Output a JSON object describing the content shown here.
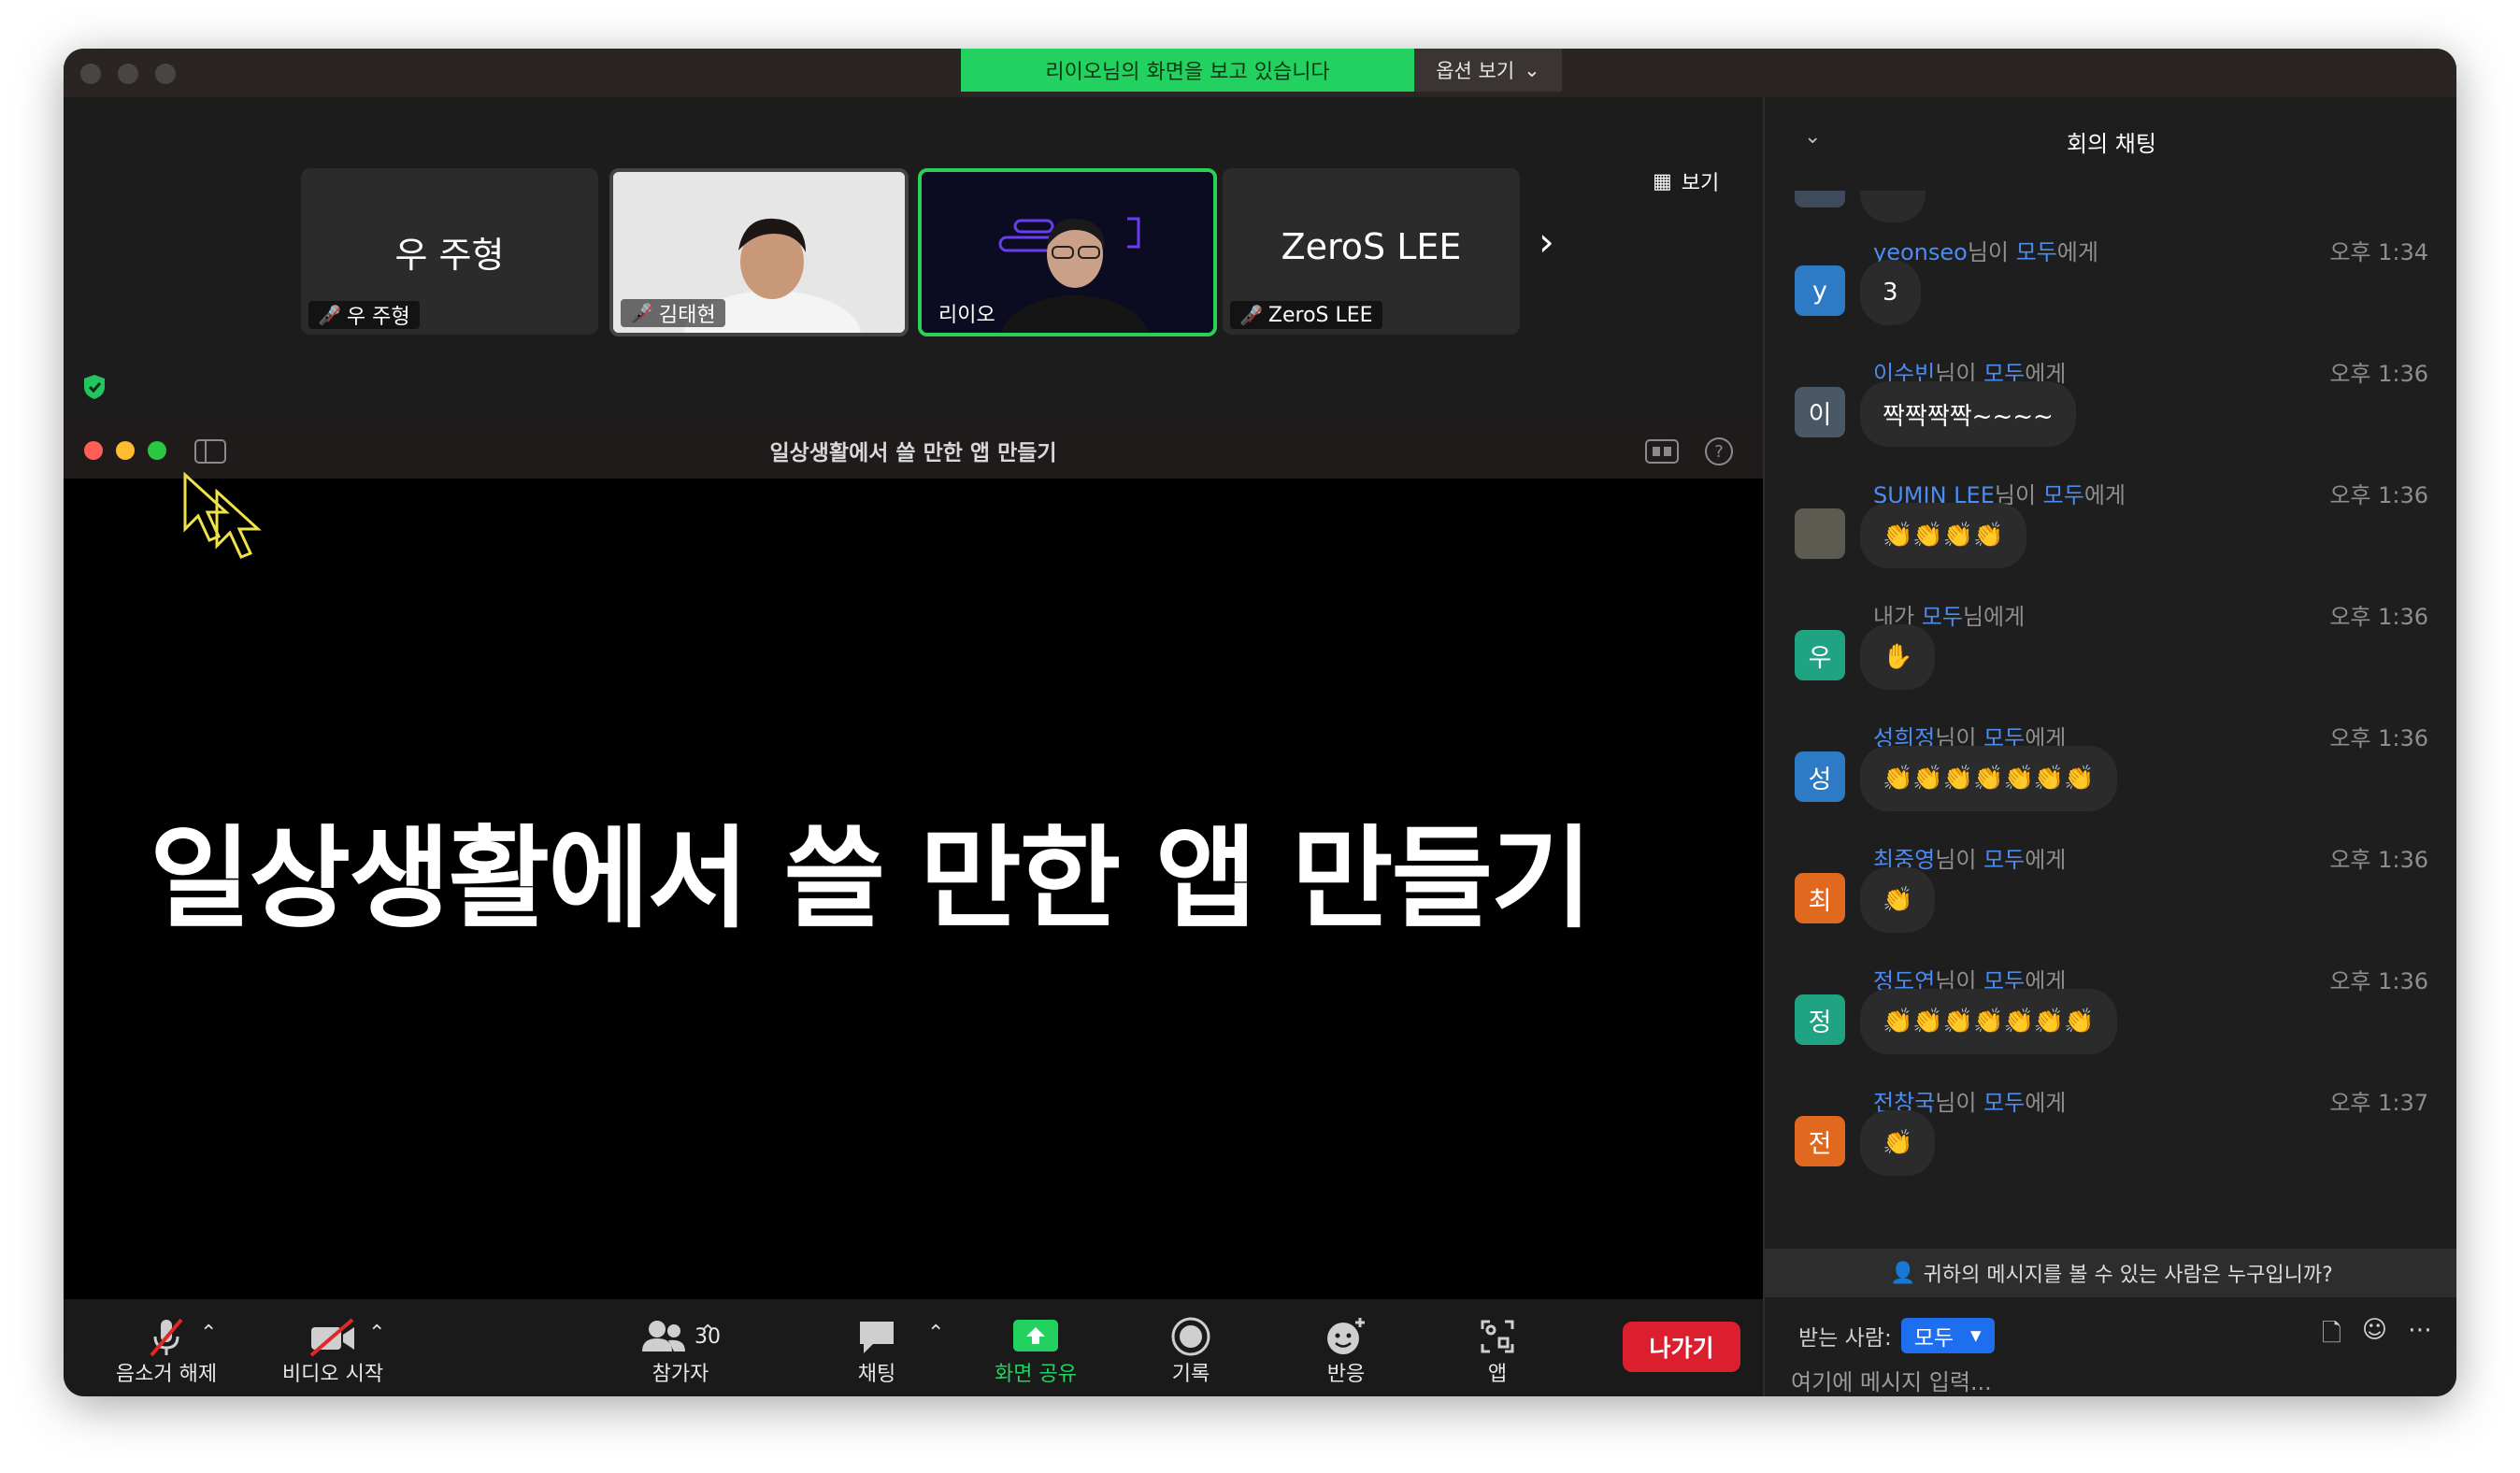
{
  "banner": {
    "sharing_text": "리이오님의 화면을 보고 있습니다",
    "view_options_label": "옵션 보기"
  },
  "thumbnails": [
    {
      "display_name": "우 주형",
      "label": "우 주형",
      "muted": true,
      "type": "name"
    },
    {
      "label": "김태현",
      "muted": true,
      "type": "video"
    },
    {
      "label": "리이오",
      "muted": false,
      "type": "video",
      "active_speaker": true
    },
    {
      "display_name": "ZeroS LEE",
      "label": "ZeroS LEE",
      "muted": true,
      "type": "name"
    }
  ],
  "view_button_label": "보기",
  "shared_window": {
    "title": "일상생활에서 쓸 만한 앱 만들기",
    "slide_text": "일상생활에서 쓸 만한 앱 만들기"
  },
  "toolbar": {
    "unmute_label": "음소거 해제",
    "video_label": "비디오 시작",
    "participants_label": "참가자",
    "participants_count": "30",
    "chat_label": "채팅",
    "share_label": "화면 공유",
    "record_label": "기록",
    "reactions_label": "반응",
    "apps_label": "앱",
    "leave_label": "나가기"
  },
  "chat": {
    "title": "회의 채팅",
    "messages": [
      {
        "sender": "yeonseo",
        "suffix": "님이 ",
        "target": "모두",
        "target_suffix": "에게",
        "time": "오후 1:34",
        "avatar_text": "y",
        "avatar_color": "#2d7bc4",
        "text": "3"
      },
      {
        "sender": "이수빈",
        "suffix": "님이 ",
        "target": "모두",
        "target_suffix": "에게",
        "time": "오후 1:36",
        "avatar_text": "이",
        "avatar_color": "#4a5866",
        "text": "짝짝짝짝~~~~"
      },
      {
        "sender": "SUMIN LEE",
        "suffix": "님이 ",
        "target": "모두",
        "target_suffix": "에게",
        "time": "오후 1:36",
        "avatar_text": "",
        "avatar_color": "#5d5a52",
        "text": "👏👏👏👏"
      },
      {
        "sender": "내가 ",
        "suffix": "",
        "target": "모두",
        "target_suffix": "님에게",
        "time": "오후 1:36",
        "avatar_text": "우",
        "avatar_color": "#1fa383",
        "text": "✋",
        "self": true
      },
      {
        "sender": "성희정",
        "suffix": "님이 ",
        "target": "모두",
        "target_suffix": "에게",
        "time": "오후 1:36",
        "avatar_text": "성",
        "avatar_color": "#2d7bc4",
        "text": "👏👏👏👏👏👏👏"
      },
      {
        "sender": "최중영",
        "suffix": "님이 ",
        "target": "모두",
        "target_suffix": "에게",
        "time": "오후 1:36",
        "avatar_text": "최",
        "avatar_color": "#e0681f",
        "text": "👏"
      },
      {
        "sender": "정도연",
        "suffix": "님이 ",
        "target": "모두",
        "target_suffix": "에게",
        "time": "오후 1:36",
        "avatar_text": "정",
        "avatar_color": "#1fa383",
        "text": "👏👏👏👏👏👏👏"
      },
      {
        "sender": "전창국",
        "suffix": "님이 ",
        "target": "모두",
        "target_suffix": "에게",
        "time": "오후 1:37",
        "avatar_text": "전",
        "avatar_color": "#e0681f",
        "text": "👏"
      }
    ],
    "privacy_text": "귀하의 메시지를 볼 수 있는 사람은 누구입니까?",
    "recipient_label": "받는 사람:",
    "recipient_value": "모두",
    "input_placeholder": "여기에 메시지 입력..."
  }
}
